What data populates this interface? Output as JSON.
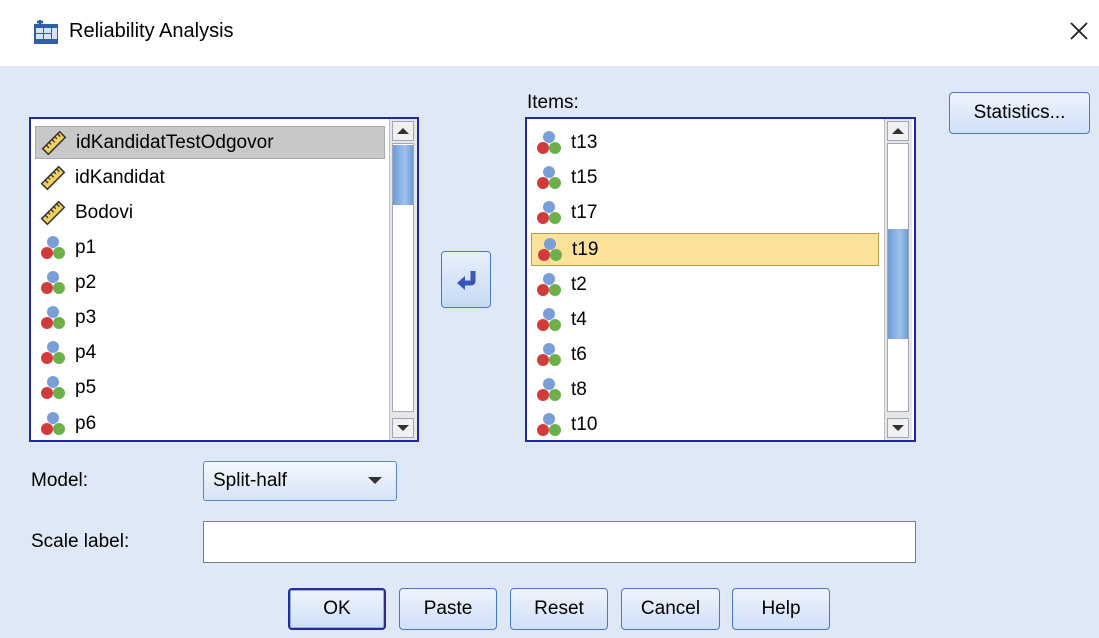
{
  "window": {
    "title": "Reliability Analysis"
  },
  "source_list": {
    "items": [
      {
        "label": "idKandidatTestOdgovor",
        "icon": "ruler-scale-icon",
        "selected": true
      },
      {
        "label": "idKandidat",
        "icon": "ruler-scale-icon"
      },
      {
        "label": "Bodovi",
        "icon": "ruler-scale-icon"
      },
      {
        "label": "p1",
        "icon": "nominal-variable-icon"
      },
      {
        "label": "p2",
        "icon": "nominal-variable-icon"
      },
      {
        "label": "p3",
        "icon": "nominal-variable-icon"
      },
      {
        "label": "p4",
        "icon": "nominal-variable-icon"
      },
      {
        "label": "p5",
        "icon": "nominal-variable-icon"
      },
      {
        "label": "p6",
        "icon": "nominal-variable-icon"
      }
    ]
  },
  "items_list": {
    "label": "Items:",
    "items": [
      {
        "label": "t13",
        "icon": "nominal-variable-icon"
      },
      {
        "label": "t15",
        "icon": "nominal-variable-icon"
      },
      {
        "label": "t17",
        "icon": "nominal-variable-icon"
      },
      {
        "label": "t19",
        "icon": "nominal-variable-icon",
        "selected": true
      },
      {
        "label": "t2",
        "icon": "nominal-variable-icon"
      },
      {
        "label": "t4",
        "icon": "nominal-variable-icon"
      },
      {
        "label": "t6",
        "icon": "nominal-variable-icon"
      },
      {
        "label": "t8",
        "icon": "nominal-variable-icon"
      },
      {
        "label": "t10",
        "icon": "nominal-variable-icon"
      }
    ]
  },
  "buttons": {
    "statistics": "Statistics...",
    "ok": "OK",
    "paste": "Paste",
    "reset": "Reset",
    "cancel": "Cancel",
    "help": "Help"
  },
  "model": {
    "label": "Model:",
    "value": "Split-half"
  },
  "scale_label": {
    "label": "Scale label:",
    "value": ""
  },
  "colors": {
    "dialog_bg": "#dfe8f6",
    "list_border": "#1e2a9a",
    "selected_item": "#fbe19a"
  }
}
